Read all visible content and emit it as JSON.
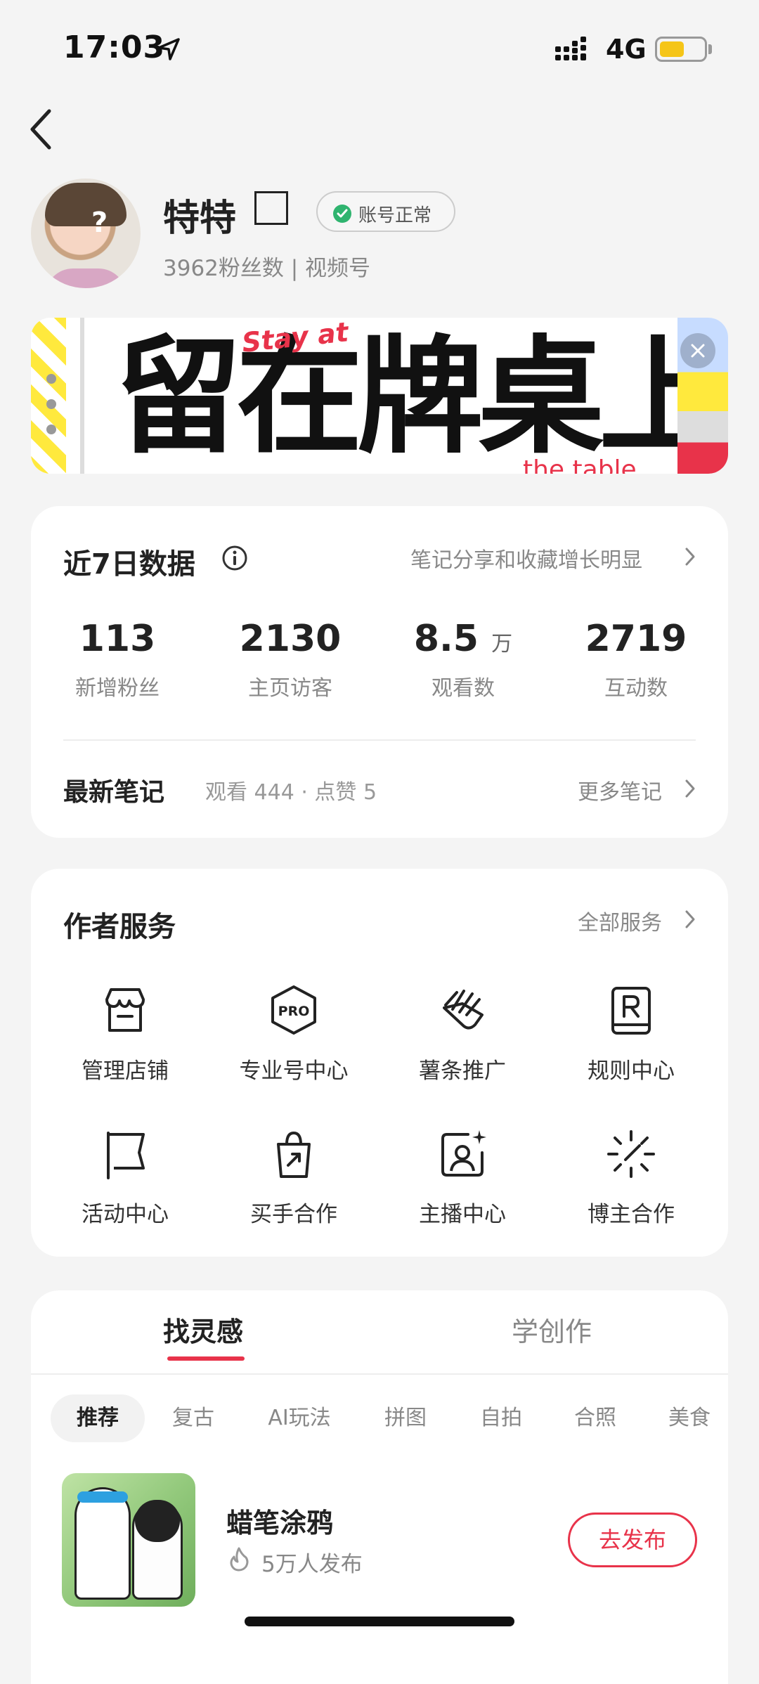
{
  "status_bar": {
    "time": "17:03",
    "network": "4G",
    "battery_level": 0.55
  },
  "profile": {
    "name": "特特",
    "account_status": "账号正常",
    "subtitle": "3962粉丝数 | 视频号"
  },
  "banner": {
    "tagline": "Stay at",
    "headline": "留在牌桌上",
    "bottom_text": "the table"
  },
  "stats_card": {
    "title": "近7日数据",
    "link": "笔记分享和收藏增长明显",
    "stats": [
      {
        "value": "113",
        "unit": "",
        "label": "新增粉丝"
      },
      {
        "value": "2130",
        "unit": "",
        "label": "主页访客"
      },
      {
        "value": "8.5",
        "unit": "万",
        "label": "观看数"
      },
      {
        "value": "2719",
        "unit": "",
        "label": "互动数"
      }
    ],
    "latest_label": "最新笔记",
    "latest_meta": "观看 444 · 点赞 5",
    "more_label": "更多笔记"
  },
  "services_card": {
    "title": "作者服务",
    "link": "全部服务",
    "items": [
      {
        "label": "管理店铺",
        "icon": "shop-icon"
      },
      {
        "label": "专业号中心",
        "icon": "pro-icon"
      },
      {
        "label": "薯条推广",
        "icon": "fries-icon"
      },
      {
        "label": "规则中心",
        "icon": "rules-book-icon"
      },
      {
        "label": "活动中心",
        "icon": "flag-icon"
      },
      {
        "label": "买手合作",
        "icon": "shopping-bag-icon"
      },
      {
        "label": "主播中心",
        "icon": "streamer-icon"
      },
      {
        "label": "博主合作",
        "icon": "sparkle-icon"
      }
    ]
  },
  "inspiration": {
    "tabs": [
      "找灵感",
      "学创作"
    ],
    "chips": [
      "推荐",
      "复古",
      "AI玩法",
      "拼图",
      "自拍",
      "合照",
      "美食"
    ],
    "trend": {
      "title": "蜡笔涂鸦",
      "sub": "5万人发布",
      "action": "去发布"
    }
  },
  "colors": {
    "accent": "#e8334a",
    "success": "#2fb46f",
    "background": "#f4f4f4"
  }
}
